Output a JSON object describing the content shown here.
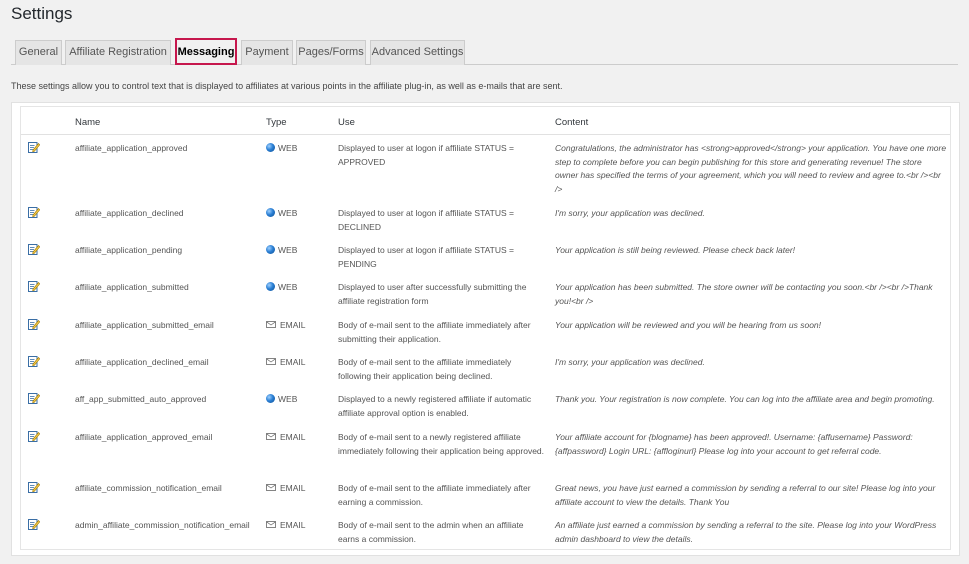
{
  "page": {
    "title": "Settings"
  },
  "tabs": [
    {
      "label": "General"
    },
    {
      "label": "Affiliate Registration"
    },
    {
      "label": "Messaging",
      "active": true
    },
    {
      "label": "Payment"
    },
    {
      "label": "Pages/Forms"
    },
    {
      "label": "Advanced Settings"
    }
  ],
  "description": "These settings allow you to control text that is displayed to affiliates at various points in the affiliate plug-in, as well as e-mails that are sent.",
  "colors": {
    "active_tab_border": "#c6174d",
    "globe": "#2a7fd4"
  },
  "table": {
    "headers": {
      "name": "Name",
      "type": "Type",
      "use": "Use",
      "content": "Content"
    },
    "rows": [
      {
        "name": "affiliate_application_approved",
        "type": "WEB",
        "type_icon": "globe-icon",
        "use": "Displayed to user at logon if affiliate STATUS = APPROVED",
        "content": "Congratulations, the administrator has <strong>approved</strong> your application. You have one more step to complete before you can begin publishing for this store and generating revenue! The store owner has specified the terms of your agreement, which you will need to review and agree to.<br /><br />"
      },
      {
        "name": "affiliate_application_declined",
        "type": "WEB",
        "type_icon": "globe-icon",
        "use": "Displayed to user at logon if affiliate STATUS = DECLINED",
        "content": "I'm sorry, your application was declined."
      },
      {
        "name": "affiliate_application_pending",
        "type": "WEB",
        "type_icon": "globe-icon",
        "use": "Displayed to user at logon if affiliate STATUS = PENDING",
        "content": "Your application is still being reviewed. Please check back later!"
      },
      {
        "name": "affiliate_application_submitted",
        "type": "WEB",
        "type_icon": "globe-icon",
        "use": "Displayed to user after successfully submitting the affiliate registration form",
        "content": "Your application has been submitted. The store owner will be contacting you soon.<br /><br />Thank you!<br />"
      },
      {
        "name": "affiliate_application_submitted_email",
        "type": "EMAIL",
        "type_icon": "envelope-icon",
        "use": "Body of e-mail sent to the affiliate immediately after submitting their application.",
        "content": "Your application will be reviewed and you will be hearing from us soon!"
      },
      {
        "name": "affiliate_application_declined_email",
        "type": "EMAIL",
        "type_icon": "envelope-icon",
        "use": "Body of e-mail sent to the affiliate immediately following their application being declined.",
        "content": "I'm sorry, your application was declined."
      },
      {
        "name": "aff_app_submitted_auto_approved",
        "type": "WEB",
        "type_icon": "globe-icon",
        "use": "Displayed to a newly registered affiliate if automatic affiliate approval option is enabled.",
        "content": "Thank you. Your registration is now complete. You can log into the affiliate area and begin promoting."
      },
      {
        "name": "affiliate_application_approved_email",
        "type": "EMAIL",
        "type_icon": "envelope-icon",
        "use": "Body of e-mail sent to a newly registered affiliate immediately following their application being approved.",
        "content": "Your affiliate account for {blogname} has been approved!. Username: {affusername} Password: {affpassword} Login URL: {affloginurl} Please log into your account to get referral code."
      },
      {
        "name": "affiliate_commission_notification_email",
        "type": "EMAIL",
        "type_icon": "envelope-icon",
        "use": "Body of e-mail sent to the affiliate immediately after earning a commission.",
        "content": "Great news, you have just earned a commission by sending a referral to our site! Please log into your affiliate account to view the details. Thank You"
      },
      {
        "name": "admin_affiliate_commission_notification_email",
        "type": "EMAIL",
        "type_icon": "envelope-icon",
        "use": "Body of e-mail sent to the admin when an affiliate earns a commission.",
        "content": "An affiliate just earned a commission by sending a referral to the site. Please log into your WordPress admin dashboard to view the details."
      }
    ]
  }
}
